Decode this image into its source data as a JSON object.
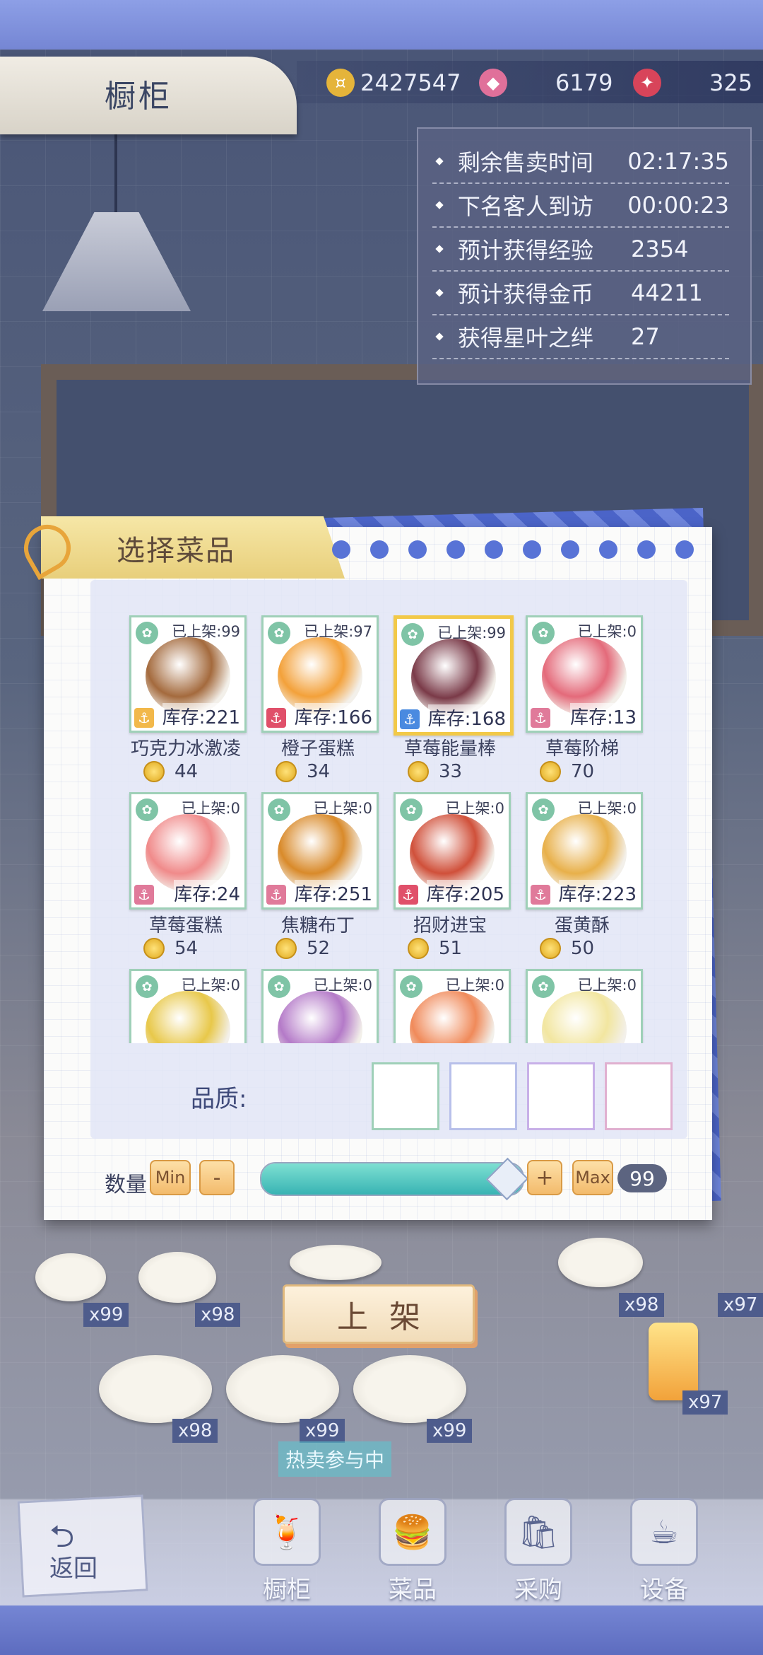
{
  "header": {
    "title": "橱柜"
  },
  "resources": [
    {
      "icon": "gold-coin-icon",
      "value": "2427547",
      "color": "#e5b43a"
    },
    {
      "icon": "gem-icon",
      "value": "6179",
      "color": "#e0709a"
    },
    {
      "icon": "star-leaf-icon",
      "value": "325",
      "color": "#d8445a"
    }
  ],
  "info": [
    {
      "label": "剩余售卖时间",
      "value": "02:17:35"
    },
    {
      "label": "下名客人到访",
      "value": "00:00:23"
    },
    {
      "label": "预计获得经验",
      "value": "2354"
    },
    {
      "label": "预计获得金币",
      "value": "44211"
    },
    {
      "label": "获得星叶之绊",
      "value": "27"
    }
  ],
  "dialog": {
    "title": "选择菜品",
    "items": [
      {
        "listed": "已上架:99",
        "stock": "库存:221",
        "name": "巧克力冰激凌",
        "price": "44",
        "food_color": "#a46a3d",
        "badge_color": "#f2b84a"
      },
      {
        "listed": "已上架:97",
        "stock": "库存:166",
        "name": "橙子蛋糕",
        "price": "34",
        "food_color": "#f3a13a",
        "badge_color": "#e0506a"
      },
      {
        "listed": "已上架:99",
        "stock": "库存:168",
        "name": "草莓能量棒",
        "price": "33",
        "food_color": "#7a3a48",
        "badge_color": "#4a8ae0"
      },
      {
        "listed": "已上架:0",
        "stock": "库存:13",
        "name": "草莓阶梯",
        "price": "70",
        "food_color": "#e46a7a",
        "badge_color": "#e07a9a"
      },
      {
        "listed": "已上架:0",
        "stock": "库存:24",
        "name": "草莓蛋糕",
        "price": "54",
        "food_color": "#f08a8a",
        "badge_color": "#e07a9a"
      },
      {
        "listed": "已上架:0",
        "stock": "库存:251",
        "name": "焦糖布丁",
        "price": "52",
        "food_color": "#d98a2a",
        "badge_color": "#e07a9a"
      },
      {
        "listed": "已上架:0",
        "stock": "库存:205",
        "name": "招财进宝",
        "price": "51",
        "food_color": "#d0503a",
        "badge_color": "#e0506a"
      },
      {
        "listed": "已上架:0",
        "stock": "库存:223",
        "name": "蛋黄酥",
        "price": "50",
        "food_color": "#e8b04a",
        "badge_color": "#e07a9a"
      },
      {
        "listed": "已上架:0",
        "food_color": "#e8c84a"
      },
      {
        "listed": "已上架:0",
        "food_color": "#b47ac8"
      },
      {
        "listed": "已上架:0",
        "food_color": "#f08a5a"
      },
      {
        "listed": "已上架:0",
        "food_color": "#f2e6a0"
      }
    ],
    "quality_label": "品质:",
    "quantity_label": "数量",
    "min_label": "Min",
    "minus_label": "-",
    "plus_label": "+",
    "max_label": "Max",
    "quantity_value": "99",
    "quantity_fraction": 1.0
  },
  "shelf_button": "上架",
  "shelf_items": [
    {
      "count": "x99"
    },
    {
      "count": "x98"
    },
    {
      "count": "x98"
    },
    {
      "count": "x99"
    },
    {
      "count": "x99"
    },
    {
      "count": "x98"
    },
    {
      "count": "x97"
    },
    {
      "count": "x97"
    }
  ],
  "hot_tag": "热卖参与中",
  "nav": {
    "back": "返回",
    "items": [
      {
        "label": "橱柜",
        "icon": "juice-glass-icon"
      },
      {
        "label": "菜品",
        "icon": "burger-icon"
      },
      {
        "label": "采购",
        "icon": "shopping-bag-icon"
      },
      {
        "label": "设备",
        "icon": "coffee-machine-icon"
      }
    ]
  }
}
